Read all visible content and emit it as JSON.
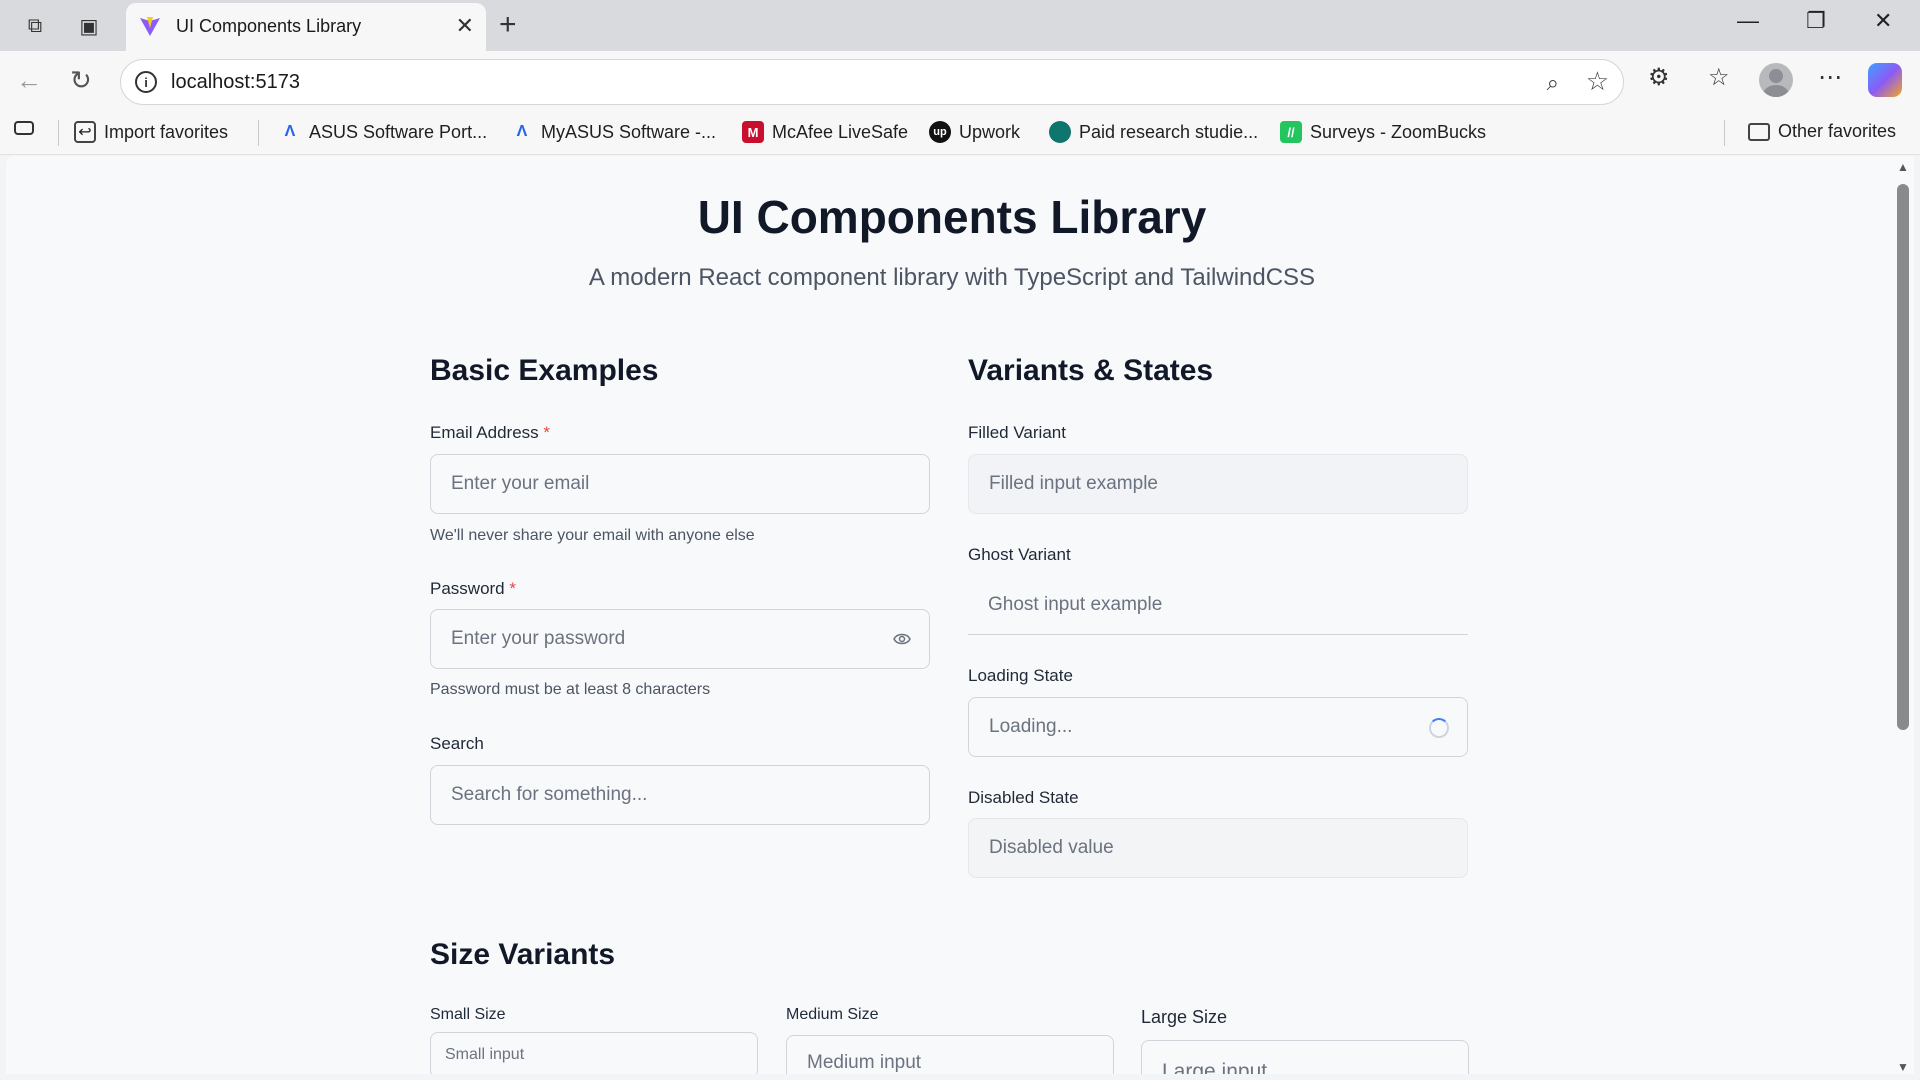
{
  "browser": {
    "tab_title": "UI Components Library",
    "url": "localhost:5173"
  },
  "favorites": [
    {
      "label": "Import favorites",
      "icon": "import-icon"
    },
    {
      "label": "ASUS Software Port...",
      "icon": "asus-icon"
    },
    {
      "label": "MyASUS Software -...",
      "icon": "asus-icon"
    },
    {
      "label": "McAfee LiveSafe",
      "icon": "mcafee-icon"
    },
    {
      "label": "Upwork",
      "icon": "upwork-icon"
    },
    {
      "label": "Paid research studie...",
      "icon": "research-icon"
    },
    {
      "label": "Surveys - ZoomBucks",
      "icon": "zoombucks-icon"
    },
    {
      "label": "Other favorites",
      "icon": "folder-icon"
    }
  ],
  "page": {
    "title": "UI Components Library",
    "subtitle": "A modern React component library with TypeScript and TailwindCSS"
  },
  "basic": {
    "heading": "Basic Examples",
    "email": {
      "label": "Email Address",
      "required": "*",
      "placeholder": "Enter your email",
      "helper": "We'll never share your email with anyone else"
    },
    "password": {
      "label": "Password",
      "required": "*",
      "placeholder": "Enter your password",
      "helper": "Password must be at least 8 characters"
    },
    "search": {
      "label": "Search",
      "placeholder": "Search for something..."
    }
  },
  "variants": {
    "heading": "Variants & States",
    "filled": {
      "label": "Filled Variant",
      "placeholder": "Filled input example"
    },
    "ghost": {
      "label": "Ghost Variant",
      "placeholder": "Ghost input example"
    },
    "loading": {
      "label": "Loading State",
      "placeholder": "Loading..."
    },
    "disabled": {
      "label": "Disabled State",
      "value": "Disabled value"
    }
  },
  "sizes": {
    "heading": "Size Variants",
    "small": {
      "label": "Small Size",
      "placeholder": "Small input"
    },
    "medium": {
      "label": "Medium Size",
      "placeholder": "Medium input"
    },
    "large": {
      "label": "Large Size",
      "placeholder": "Large input"
    }
  },
  "colors": {
    "accent": "#3b82f6",
    "required": "#ef4444",
    "text": "#111827"
  }
}
